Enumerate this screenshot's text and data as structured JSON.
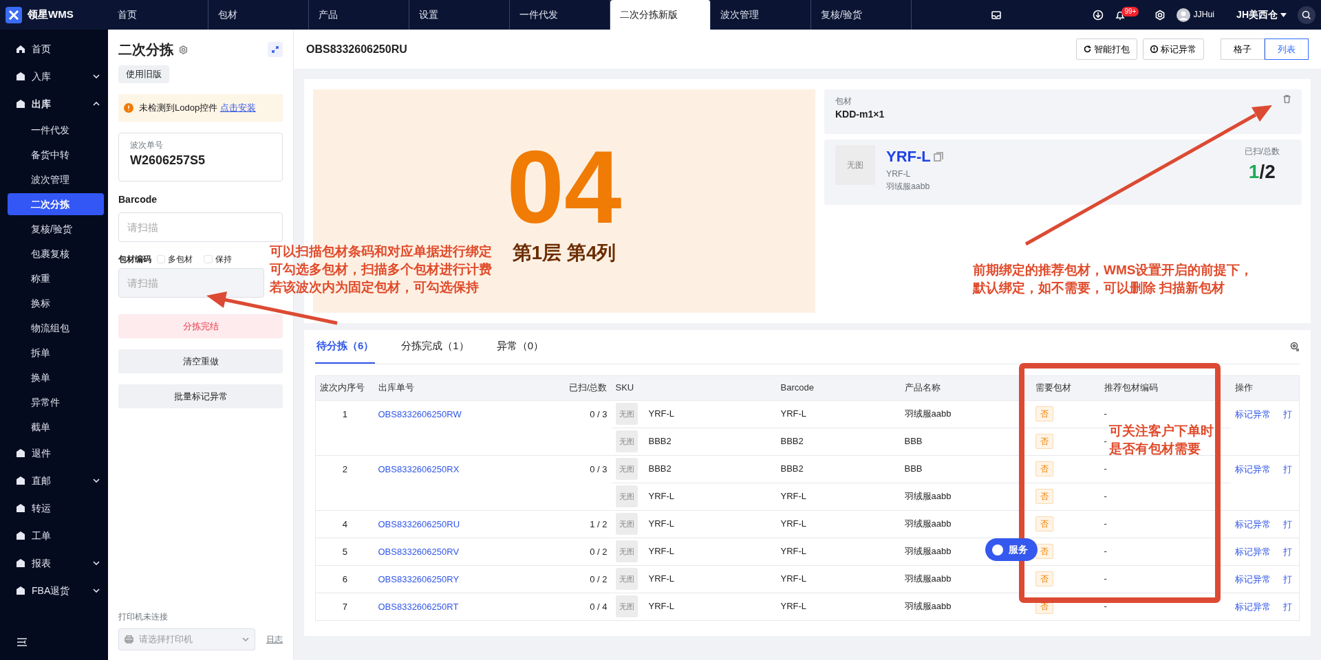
{
  "topbar": {
    "logo": "领星WMS",
    "tabs": [
      {
        "label": "首页",
        "selected": false
      },
      {
        "label": "包材",
        "selected": false
      },
      {
        "label": "产品",
        "selected": false
      },
      {
        "label": "设置",
        "selected": false
      },
      {
        "label": "一件代发",
        "selected": false
      },
      {
        "label": "二次分拣新版",
        "selected": true
      },
      {
        "label": "波次管理",
        "selected": false
      },
      {
        "label": "复核/验货",
        "selected": false
      }
    ],
    "notification_count": "99+",
    "user": "JJHui",
    "warehouse": "JH美西仓"
  },
  "sidebar": {
    "items": [
      {
        "kind": "link",
        "label": "首页"
      },
      {
        "kind": "group",
        "label": "入库",
        "expanded": false
      },
      {
        "kind": "group",
        "label": "出库",
        "expanded": true,
        "children": [
          {
            "label": "一件代发",
            "selected": false
          },
          {
            "label": "备货中转",
            "selected": false
          },
          {
            "label": "波次管理",
            "selected": false
          },
          {
            "label": "二次分拣",
            "selected": true
          },
          {
            "label": "复核/验货",
            "selected": false
          },
          {
            "label": "包裹复核",
            "selected": false
          },
          {
            "label": "称重",
            "selected": false
          },
          {
            "label": "换标",
            "selected": false
          },
          {
            "label": "物流组包",
            "selected": false
          },
          {
            "label": "拆单",
            "selected": false
          },
          {
            "label": "换单",
            "selected": false
          },
          {
            "label": "异常件",
            "selected": false
          },
          {
            "label": "截单",
            "selected": false
          }
        ]
      },
      {
        "kind": "link",
        "label": "退件"
      },
      {
        "kind": "group",
        "label": "直邮",
        "expanded": false
      },
      {
        "kind": "link",
        "label": "转运"
      },
      {
        "kind": "link",
        "label": "工单"
      },
      {
        "kind": "group",
        "label": "报表",
        "expanded": false
      },
      {
        "kind": "group",
        "label": "FBA退货",
        "expanded": false
      }
    ]
  },
  "scan_panel": {
    "title": "二次分拣",
    "old_version_button": "使用旧版",
    "alert": {
      "text": "未检测到Lodop控件",
      "link": "点击安装"
    },
    "wave": {
      "label": "波次单号",
      "value": "W2606257S5"
    },
    "barcode": {
      "label": "Barcode",
      "placeholder": "请扫描"
    },
    "packaging": {
      "label": "包材编码",
      "options": [
        {
          "label": "多包材",
          "checked": false
        },
        {
          "label": "保持",
          "checked": false
        }
      ],
      "placeholder": "请扫描"
    },
    "buttons": [
      {
        "label": "分拣完结",
        "kind": "danger"
      },
      {
        "label": "清空重做",
        "kind": "plain"
      },
      {
        "label": "批量标记异常",
        "kind": "plain"
      }
    ],
    "printer": {
      "status": "打印机未连接",
      "placeholder": "请选择打印机",
      "log_link": "日志"
    }
  },
  "order_header": {
    "order_no": "OBS8332606250RU",
    "buttons": [
      "智能打包",
      "标记异常"
    ],
    "views": [
      {
        "label": "格子",
        "selected": false
      },
      {
        "label": "列表",
        "selected": true
      }
    ]
  },
  "slot": {
    "number": "04",
    "location": "第1层 第4列"
  },
  "packaging_card": {
    "label": "包材",
    "value": "KDD-m1×1"
  },
  "current_item": {
    "image": "无图",
    "sku": "YRF-L",
    "barcode": "YRF-L",
    "name": "羽绒服aabb",
    "count_label": "已扫/总数",
    "scanned": "1",
    "total": "/2"
  },
  "list_tabs": [
    {
      "label": "待分拣（6）",
      "selected": true
    },
    {
      "label": "分拣完成（1）",
      "selected": false
    },
    {
      "label": "异常（0）",
      "selected": false
    }
  ],
  "table": {
    "columns": [
      "波次内序号",
      "出库单号",
      "已扫/总数",
      "SKU",
      "Barcode",
      "产品名称",
      "需要包材",
      "推荐包材编码",
      "操作"
    ],
    "rows": [
      {
        "seq": "1",
        "order_no": "OBS8332606250RW",
        "progress": "0 / 3",
        "items": [
          {
            "image": "无图",
            "sku": "YRF-L",
            "barcode": "YRF-L",
            "product_name": "羽绒服aabb",
            "needs_packaging": "否",
            "recommended_packaging": "-"
          },
          {
            "image": "无图",
            "sku": "BBB2",
            "barcode": "BBB2",
            "product_name": "BBB",
            "needs_packaging": "否",
            "recommended_packaging": "-"
          }
        ],
        "actions": [
          "标记异常",
          "打"
        ]
      },
      {
        "seq": "2",
        "order_no": "OBS8332606250RX",
        "progress": "0 / 3",
        "items": [
          {
            "image": "无图",
            "sku": "BBB2",
            "barcode": "BBB2",
            "product_name": "BBB",
            "needs_packaging": "否",
            "recommended_packaging": "-"
          },
          {
            "image": "无图",
            "sku": "YRF-L",
            "barcode": "YRF-L",
            "product_name": "羽绒服aabb",
            "needs_packaging": "否",
            "recommended_packaging": "-"
          }
        ],
        "actions": [
          "标记异常",
          "打"
        ]
      },
      {
        "seq": "4",
        "order_no": "OBS8332606250RU",
        "progress": "1 / 2",
        "items": [
          {
            "image": "无图",
            "sku": "YRF-L",
            "barcode": "YRF-L",
            "product_name": "羽绒服aabb",
            "needs_packaging": "否",
            "recommended_packaging": "-"
          }
        ],
        "actions": [
          "标记异常",
          "打"
        ]
      },
      {
        "seq": "5",
        "order_no": "OBS8332606250RV",
        "progress": "0 / 2",
        "items": [
          {
            "image": "无图",
            "sku": "YRF-L",
            "barcode": "YRF-L",
            "product_name": "羽绒服aabb",
            "needs_packaging": "否",
            "recommended_packaging": "-"
          }
        ],
        "actions": [
          "标记异常",
          "打"
        ]
      },
      {
        "seq": "6",
        "order_no": "OBS8332606250RY",
        "progress": "0 / 2",
        "items": [
          {
            "image": "无图",
            "sku": "YRF-L",
            "barcode": "YRF-L",
            "product_name": "羽绒服aabb",
            "needs_packaging": "否",
            "recommended_packaging": "-"
          }
        ],
        "actions": [
          "标记异常",
          "打"
        ]
      },
      {
        "seq": "7",
        "order_no": "OBS8332606250RT",
        "progress": "0 / 4",
        "items": [
          {
            "image": "无图",
            "sku": "YRF-L",
            "barcode": "YRF-L",
            "product_name": "羽绒服aabb",
            "needs_packaging": "否",
            "recommended_packaging": "-"
          }
        ],
        "actions": [
          "标记异常",
          "打"
        ]
      }
    ]
  },
  "service_button": "服务",
  "annotations": [
    {
      "lines": [
        "可以扫描包材条码和对应单据进行绑定",
        "可勾选多包材，扫描多个包材进行计费",
        "若该波次内为固定包材，可勾选保持"
      ]
    },
    {
      "lines": [
        "前期绑定的推荐包材，WMS设置开启的前提下，",
        "默认绑定，如不需要，可以删除 扫描新包材"
      ]
    },
    {
      "lines": [
        "可关注客户下单时",
        "是否有包材需要"
      ]
    }
  ]
}
